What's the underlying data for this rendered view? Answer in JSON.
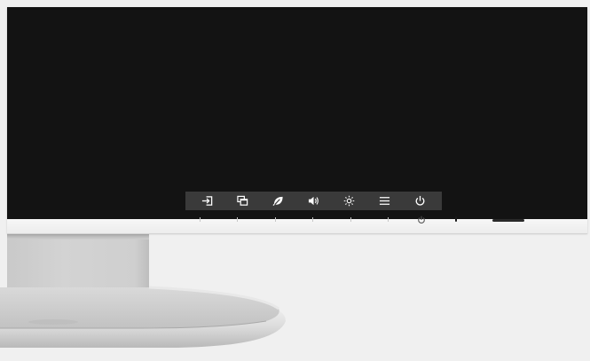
{
  "osd_bar": {
    "buttons": [
      {
        "name": "input-select",
        "icon": "input-icon"
      },
      {
        "name": "picture-mode",
        "icon": "overlapping-windows-icon"
      },
      {
        "name": "eco-mode",
        "icon": "leaf-icon"
      },
      {
        "name": "volume",
        "icon": "speaker-icon"
      },
      {
        "name": "brightness",
        "icon": "sun-icon"
      },
      {
        "name": "menu",
        "icon": "hamburger-menu-icon"
      },
      {
        "name": "power",
        "icon": "power-icon"
      }
    ],
    "icon_color": "#ffffff",
    "background_color": "#3a3a3a"
  },
  "colors": {
    "screen": "#131313",
    "bezel": "#f2f2f2",
    "stand": "#d0d0d0",
    "background": "#f0f0f0"
  }
}
